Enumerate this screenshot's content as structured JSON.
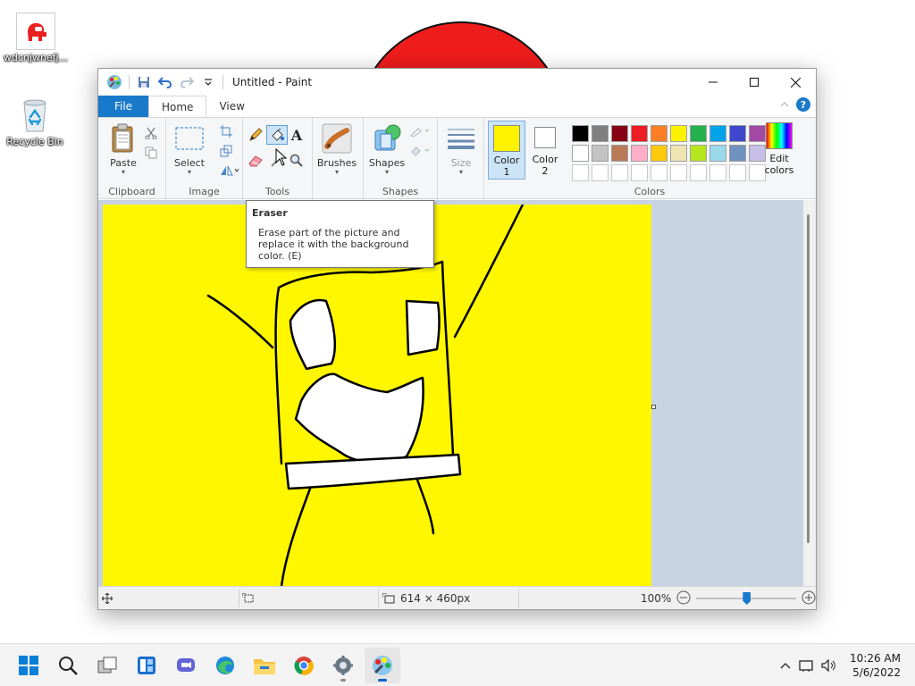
{
  "desktop": {
    "icons": [
      {
        "label": "wdcnjwnefj..."
      },
      {
        "label": "Recycle Bin"
      }
    ]
  },
  "window": {
    "title": "Untitled - Paint",
    "tabs": [
      "File",
      "Home",
      "View"
    ],
    "ribbon": {
      "clipboard": {
        "paste_label": "Paste",
        "group_label": "Clipboard"
      },
      "image": {
        "select_label": "Select",
        "group_label": "Image"
      },
      "tools": {
        "group_label": "Tools"
      },
      "brushes": {
        "label": "Brushes"
      },
      "shapes": {
        "label": "Shapes",
        "group_label": "Shapes"
      },
      "size": {
        "label": "Size"
      },
      "color1": {
        "label_line1": "Color",
        "label_line2": "1",
        "color": "#fff200"
      },
      "color2": {
        "label_line1": "Color",
        "label_line2": "2",
        "color": "#ffffff"
      },
      "edit_colors": {
        "label_line1": "Edit",
        "label_line2": "colors"
      },
      "colors_group_label": "Colors",
      "palette_row1": [
        "#000000",
        "#7f7f7f",
        "#880015",
        "#ed1c24",
        "#ff7f27",
        "#fff200",
        "#22b14c",
        "#00a2e8",
        "#3f48cc",
        "#a349a4"
      ],
      "palette_row2": [
        "#ffffff",
        "#c3c3c3",
        "#b97a57",
        "#ffaec9",
        "#ffc90e",
        "#efe4b0",
        "#b5e61d",
        "#99d9ea",
        "#7092be",
        "#c8bfe7"
      ]
    },
    "canvas": {
      "background": "#fff700"
    },
    "tooltip": {
      "title": "Eraser",
      "body": "Erase part of the picture and replace it with the background color. (E)"
    },
    "statusbar": {
      "image_size": "614 × 460px",
      "zoom": "100%"
    }
  },
  "taskbar": {
    "apps": [
      "start-icon",
      "search-icon",
      "task-view-icon",
      "widgets-icon",
      "teams-chat-icon",
      "edge-icon",
      "file-explorer-icon",
      "chrome-icon",
      "settings-icon",
      "paint-icon"
    ],
    "time": "10:26 AM",
    "date": "5/6/2022"
  }
}
